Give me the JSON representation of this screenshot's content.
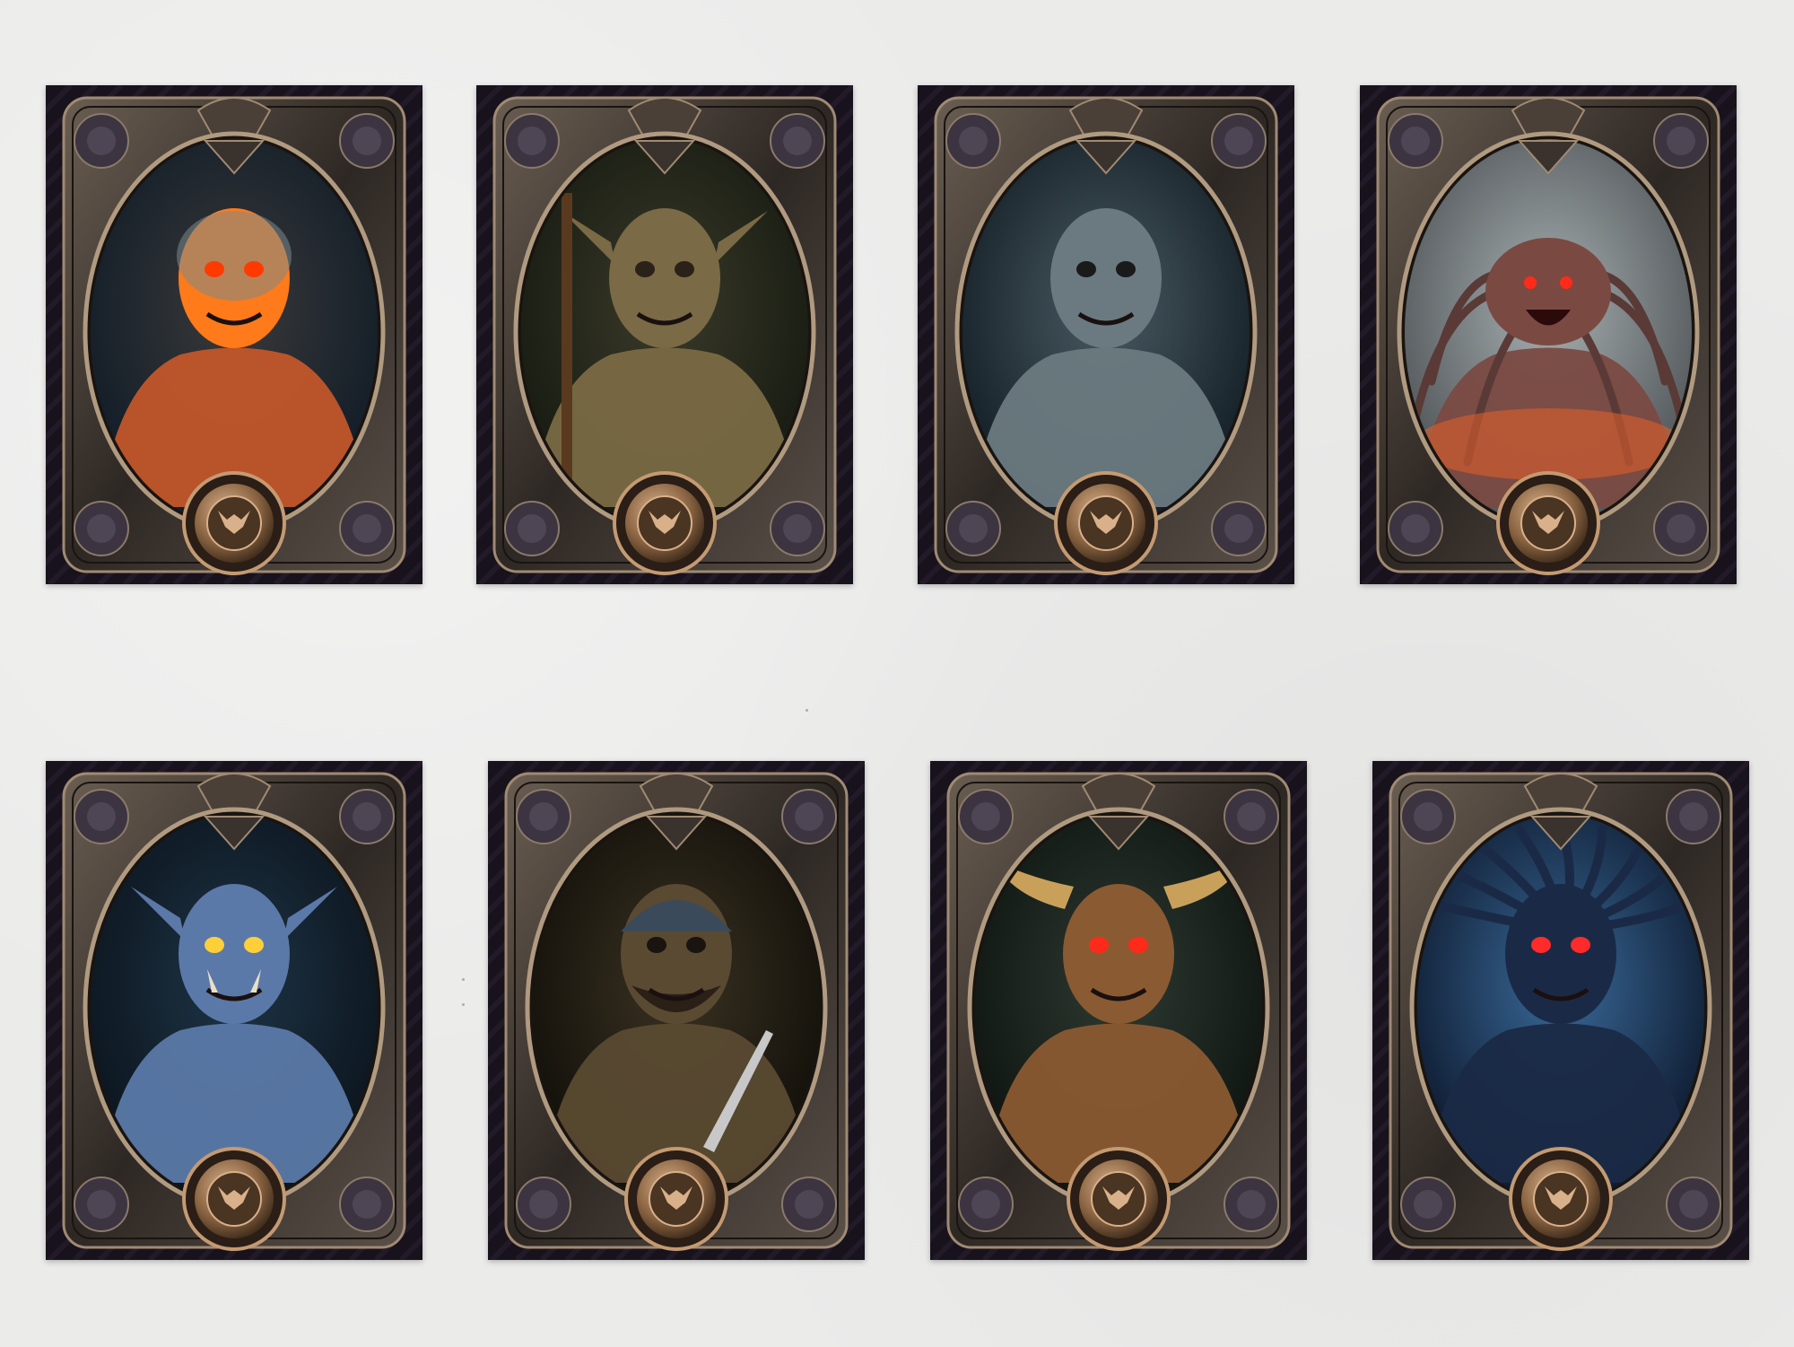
{
  "cards": [
    {
      "subject": "skull-knight",
      "colors": {
        "bg_center": "#3a3a3a",
        "bg_edge": "#0e1a26",
        "figure": "#c2562a",
        "accent": "#ff7a1a",
        "eye": "#ff3a00"
      }
    },
    {
      "subject": "troll",
      "colors": {
        "bg_center": "#3a3a2a",
        "bg_edge": "#14180f",
        "figure": "#7a6a45",
        "accent": "#a08a5a",
        "eye": "#2a2218"
      }
    },
    {
      "subject": "zombie",
      "colors": {
        "bg_center": "#4a5a62",
        "bg_edge": "#0f1a22",
        "figure": "#6a7a80",
        "accent": "#a8b8bc",
        "eye": "#1a1a1a"
      }
    },
    {
      "subject": "spider-demon",
      "colors": {
        "bg_center": "#a8b0b2",
        "bg_edge": "#4a4f52",
        "figure": "#7a4a42",
        "accent": "#e8602a",
        "eye": "#ff2a1a"
      }
    },
    {
      "subject": "blue-orc",
      "colors": {
        "bg_center": "#1e3446",
        "bg_edge": "#0a121a",
        "figure": "#5b79a8",
        "accent": "#a68a4a",
        "eye": "#ffcf3a"
      }
    },
    {
      "subject": "bandit",
      "colors": {
        "bg_center": "#3a3222",
        "bg_edge": "#0f0d08",
        "figure": "#5a4a32",
        "accent": "#c8c8c8",
        "eye": "#1a1410"
      }
    },
    {
      "subject": "minotaur",
      "colors": {
        "bg_center": "#2e3a32",
        "bg_edge": "#0c120e",
        "figure": "#8a5a32",
        "accent": "#c8a05a",
        "eye": "#ff2a1a"
      }
    },
    {
      "subject": "shadow-witch",
      "colors": {
        "bg_center": "#3a6a9a",
        "bg_edge": "#0a1426",
        "figure": "#1a2a46",
        "accent": "#5aa8e8",
        "eye": "#ff2a2a"
      }
    }
  ]
}
